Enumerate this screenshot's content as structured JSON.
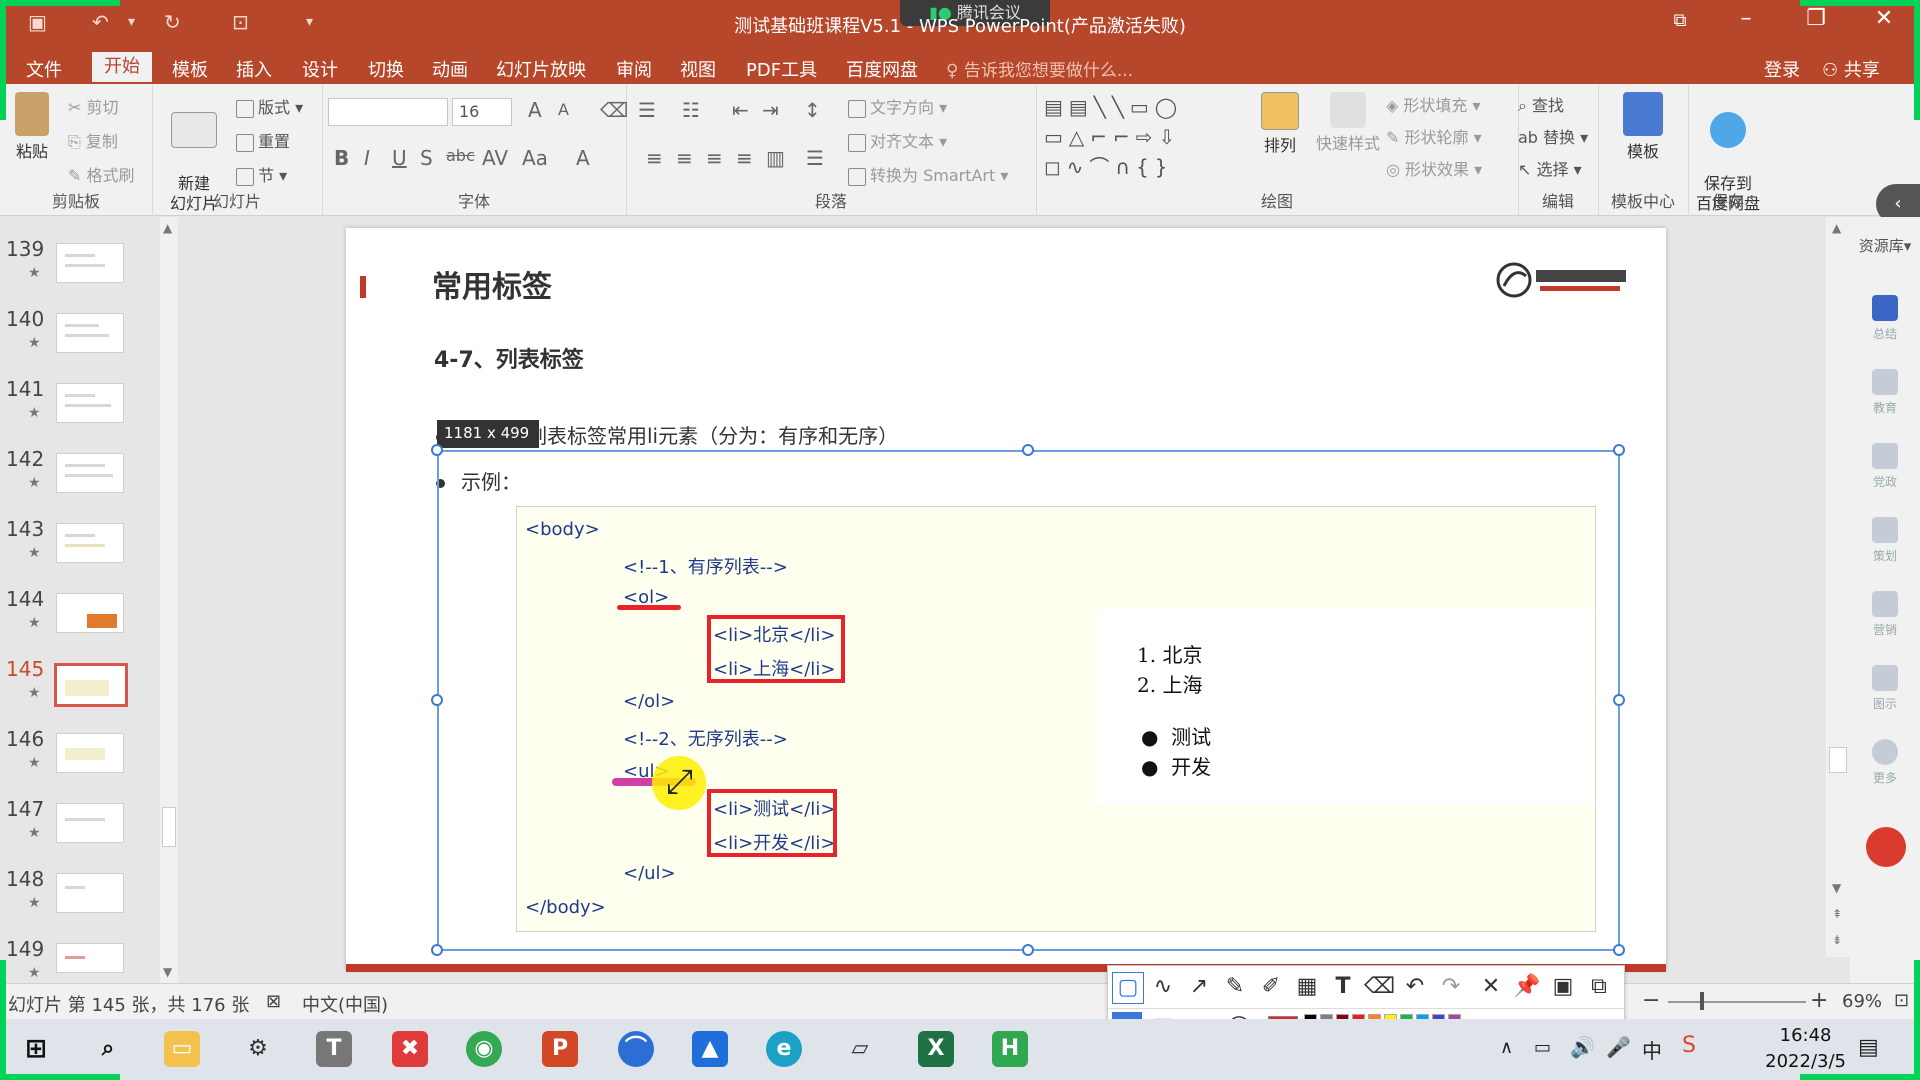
{
  "window": {
    "title": "测试基础班课程V5.1 - WPS PowerPoint(产品激活失败)",
    "meeting_badge": "腾讯会议",
    "login": "登录",
    "share": "共享",
    "tellme": "告诉我您想要做什么..."
  },
  "tabs": [
    "文件",
    "开始",
    "模板",
    "插入",
    "设计",
    "切换",
    "动画",
    "幻灯片放映",
    "审阅",
    "视图",
    "PDF工具",
    "百度网盘"
  ],
  "active_tab": "开始",
  "ribbon": {
    "clipboard": {
      "label": "剪贴板",
      "paste": "粘贴",
      "cut": "剪切",
      "copy": "复制",
      "format_painter": "格式刷"
    },
    "slides": {
      "label": "幻灯片",
      "new_slide": "新建\n幻灯片",
      "layout": "版式",
      "reset": "重置",
      "section": "节"
    },
    "font": {
      "label": "字体",
      "font_name": "",
      "font_size": "16"
    },
    "paragraph": {
      "label": "段落",
      "text_direction": "文字方向",
      "align_text": "对齐文本",
      "convert_smartart": "转换为 SmartArt"
    },
    "drawing": {
      "label": "绘图",
      "arrange": "排列",
      "quick_style": "快速样式",
      "shape_fill": "形状填充",
      "shape_outline": "形状轮廓",
      "shape_effect": "形状效果"
    },
    "editing": {
      "label": "编辑",
      "find": "查找",
      "replace": "替换",
      "select": "选择"
    },
    "template_center": {
      "label": "模板中心",
      "template": "模板"
    },
    "save": {
      "label": "保存",
      "save_to_baidu": "保存到\n百度网盘"
    }
  },
  "thumbnails": [
    {
      "num": "139",
      "selected": false
    },
    {
      "num": "140",
      "selected": false
    },
    {
      "num": "141",
      "selected": false
    },
    {
      "num": "142",
      "selected": false
    },
    {
      "num": "143",
      "selected": false
    },
    {
      "num": "144",
      "selected": false
    },
    {
      "num": "145",
      "selected": true
    },
    {
      "num": "146",
      "selected": false
    },
    {
      "num": "147",
      "selected": false
    },
    {
      "num": "148",
      "selected": false
    },
    {
      "num": "149",
      "selected": false
    }
  ],
  "slide": {
    "title": "常用标签",
    "subtitle": "4-7、列表标签",
    "bullet1": "列表标签常用li元素（分为：有序和无序）",
    "bullet2": "示例：",
    "selection_dims": "1181  x  499",
    "code_lines": [
      "<body>",
      "<!--1、有序列表-->",
      "<ol>",
      "<li>北京</li>",
      "<li>上海</li>",
      "</ol>",
      "<!--2、无序列表-->",
      "<ul>",
      "<li>测试</li>",
      "<li>开发</li>",
      "</ul>",
      "</body>"
    ],
    "output": {
      "ol_markers": [
        "1.",
        "2."
      ],
      "ol_items": [
        "北京",
        "上海"
      ],
      "ul_items": [
        "测试",
        "开发"
      ]
    }
  },
  "right_panel": {
    "resource": "资源库",
    "items": [
      "总结",
      "教育",
      "党政",
      "策划",
      "营销",
      "图示",
      "更多"
    ]
  },
  "status": {
    "slide_info": "幻灯片 第 145 张，共 176 张",
    "language": "中文(中国)",
    "zoom": "69%"
  },
  "taskbar": {
    "time": "16:48",
    "date": "2022/3/5",
    "ime": "中"
  },
  "colors": {
    "title_bar": "#b7472a",
    "accent_red": "#e8232b",
    "code_text": "#1e3b8a",
    "selection": "#3a7ad6"
  }
}
